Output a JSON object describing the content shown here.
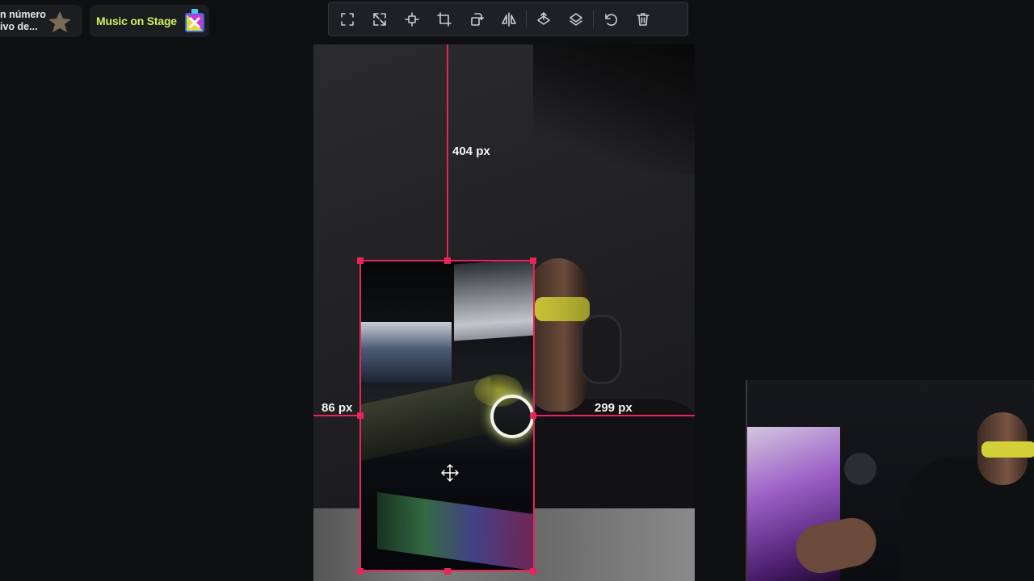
{
  "chips": {
    "chip1_line1": "n número",
    "chip1_line2": "ivo de...",
    "chip2_label": "Music on Stage"
  },
  "toolbar": {
    "buttons": [
      "fullscreen-icon",
      "fit-icon",
      "center-icon",
      "crop-icon",
      "rotate-icon",
      "flip-icon",
      "bring-forward-icon",
      "send-backward-icon",
      "undo-icon",
      "delete-icon"
    ]
  },
  "measurements": {
    "top": "404 px",
    "left": "86 px",
    "right": "299 px"
  },
  "colors": {
    "accent": "#e8245a",
    "chip_text": "#cdf25e"
  }
}
